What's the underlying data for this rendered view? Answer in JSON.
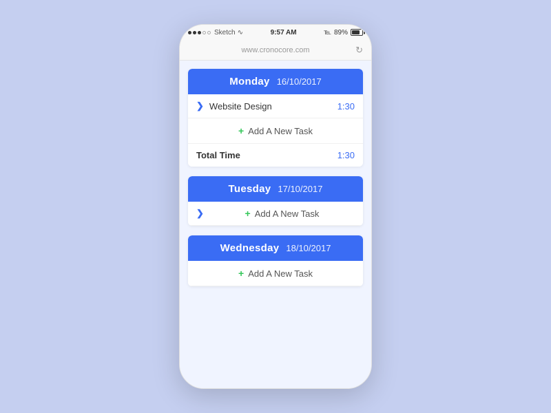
{
  "statusBar": {
    "time": "9:57 AM",
    "battery_pct": "89%",
    "carrier": "Sketch",
    "dots_filled": 3,
    "dots_empty": 2
  },
  "urlBar": {
    "url": "www.cronocore.com"
  },
  "days": [
    {
      "name": "Monday",
      "date": "16/10/2017",
      "tasks": [
        {
          "name": "Website Design",
          "time": "1:30"
        }
      ],
      "add_label": "Add A New Task",
      "total_label": "Total Time",
      "total_time": "1:30"
    },
    {
      "name": "Tuesday",
      "date": "17/10/2017",
      "tasks": [],
      "add_label": "Add A New Task",
      "total_label": null,
      "total_time": null
    },
    {
      "name": "Wednesday",
      "date": "18/10/2017",
      "tasks": [],
      "add_label": "Add A New Task",
      "total_label": null,
      "total_time": null
    }
  ],
  "icons": {
    "chevron": "❯",
    "add": "+",
    "reload": "↻",
    "bluetooth": "⌁",
    "wifi": "⌇"
  }
}
